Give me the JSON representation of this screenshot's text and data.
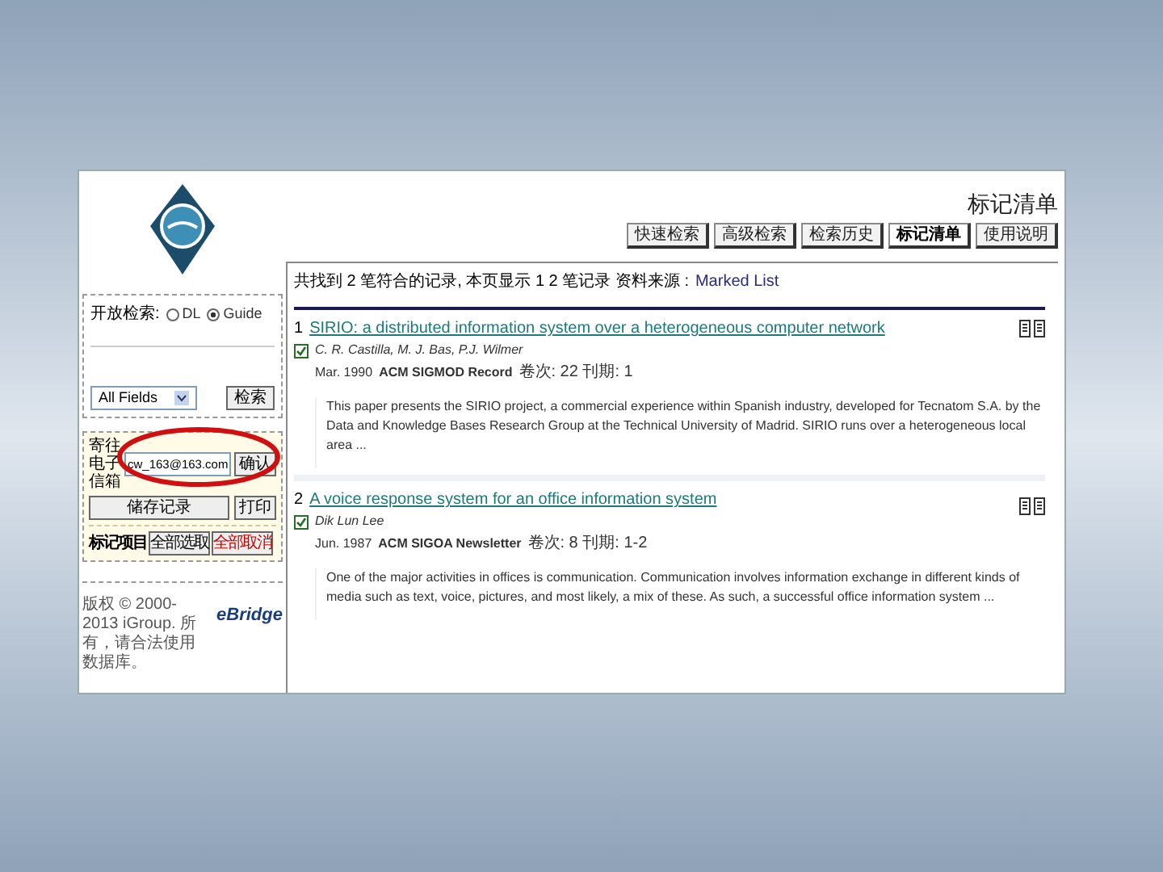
{
  "page_title": "标记清单",
  "nav_tabs": [
    {
      "label": "快速检索",
      "selected": false
    },
    {
      "label": "高级检索",
      "selected": false
    },
    {
      "label": "检索历史",
      "selected": false
    },
    {
      "label": "标记清单",
      "selected": true
    },
    {
      "label": "使用说明",
      "selected": false
    }
  ],
  "sidebar": {
    "open_search_label": "开放检索:",
    "sources": [
      {
        "label": "DL",
        "selected": false
      },
      {
        "label": "Guide",
        "selected": true
      }
    ],
    "field_select": "All Fields",
    "search_button": "检索",
    "email_label": "寄往电子信箱",
    "email_value": "cw_163@163.com",
    "confirm_button": "确认",
    "save_button": "储存记录",
    "print_button": "打印",
    "mark_label": "标记项目",
    "select_all_button": "全部选取",
    "clear_all_button": "全部取消",
    "copyright": "版权 © 2000-2013 iGroup. 所有，请合法使用数据库。",
    "logo": "eBridge"
  },
  "summary": {
    "text": "共找到 2 笔符合的记录, 本页显示 1 2 笔记录 资料来源 :",
    "source": "Marked List"
  },
  "records": [
    {
      "number": "1",
      "title": "SIRIO: a distributed information system over a heterogeneous computer network",
      "checked": true,
      "authors": "C. R. Castilla, M. J. Bas, P.J. Wilmer",
      "date": "Mar. 1990",
      "journal": "ACM SIGMOD Record",
      "volume": "卷次: 22 刊期: 1",
      "abstract": "This paper presents the SIRIO project, a commercial experience within Spanish industry, developed for Tecnatom S.A. by the Data and Knowledge Bases Research Group at the Technical University of Madrid. SIRIO runs over a heterogeneous local area ..."
    },
    {
      "number": "2",
      "title": "A voice response system for an office information system",
      "checked": true,
      "authors": "Dik Lun Lee",
      "date": "Jun. 1987",
      "journal": "ACM SIGOA Newsletter",
      "volume": "卷次: 8 刊期: 1-2",
      "abstract": "One of the major activities in offices is communication. Communication involves information exchange in different kinds of media such as text, voice, pictures, and most likely, a mix of these. As such, a successful office information system ..."
    }
  ]
}
